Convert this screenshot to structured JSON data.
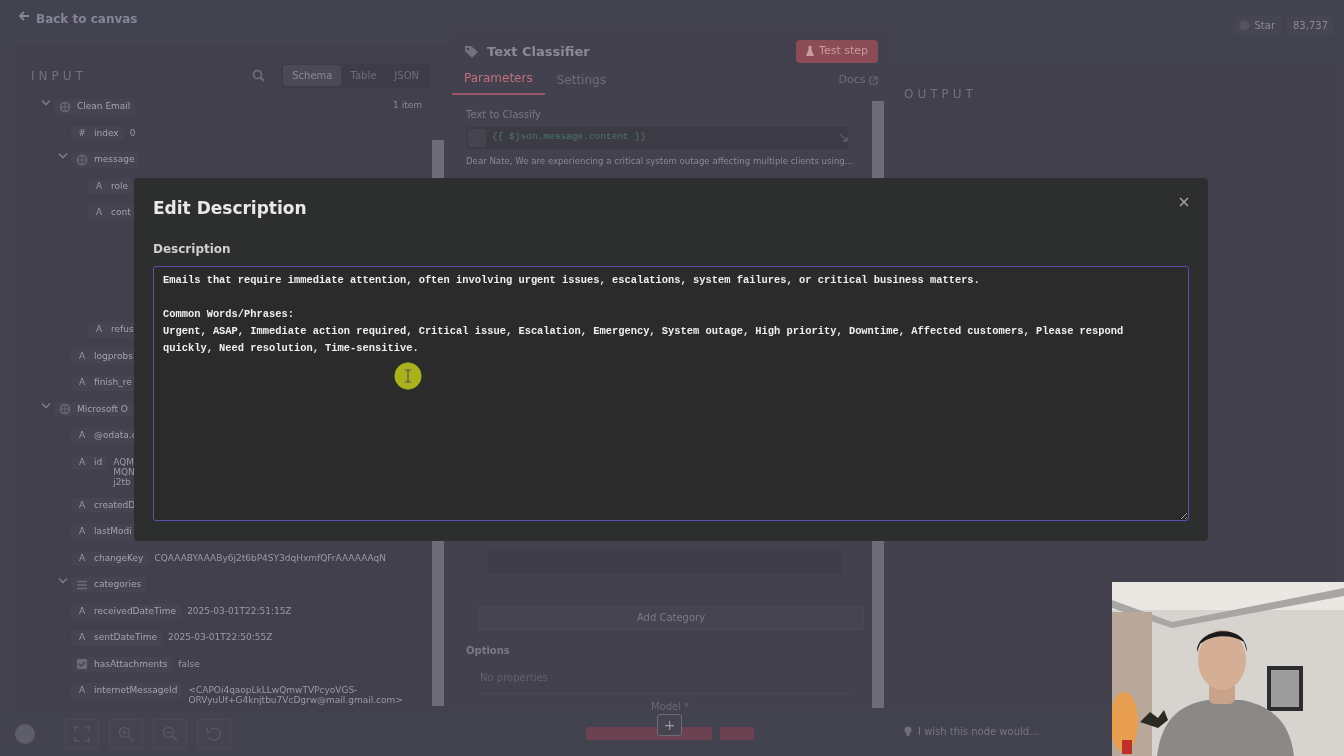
{
  "header": {
    "back_link": "Back to canvas",
    "star_label": "Star",
    "star_count": "83,737"
  },
  "input_panel": {
    "title": "INPUT",
    "view_tabs": [
      {
        "label": "Schema",
        "selected": true
      },
      {
        "label": "Table",
        "selected": false
      },
      {
        "label": "JSON",
        "selected": false
      }
    ],
    "tree": [
      {
        "kind": "object",
        "key": "Clean Email",
        "meta": "1 item",
        "expanded": true,
        "children": [
          {
            "kind": "number",
            "mark": "#",
            "key": "index",
            "value": "0"
          },
          {
            "kind": "object",
            "key": "message",
            "expanded": true,
            "children": [
              {
                "kind": "string",
                "mark": "A",
                "key": "role"
              },
              {
                "kind": "text",
                "mark": "A",
                "key": "cont"
              },
              {
                "kind": "string",
                "mark": "A",
                "key": "refus"
              }
            ]
          },
          {
            "kind": "string",
            "mark": "A",
            "key": "logprobs"
          },
          {
            "kind": "string",
            "mark": "A",
            "key": "finish_re"
          }
        ]
      },
      {
        "kind": "object",
        "key": "Microsoft O",
        "expanded": true,
        "children": [
          {
            "kind": "string",
            "mark": "A",
            "key": "@odata.c"
          },
          {
            "kind": "string",
            "mark": "A",
            "key": "id",
            "value": "AQM\nMQN\nj2tb"
          },
          {
            "kind": "string",
            "mark": "A",
            "key": "createdD"
          },
          {
            "kind": "string",
            "mark": "A",
            "key": "lastModi"
          },
          {
            "kind": "string",
            "mark": "A",
            "key": "changeKey",
            "value": "CQAAABYAAABy6j2t6bP4SY3dqHxmfQFrAAAAAAqN"
          },
          {
            "kind": "list",
            "key": "categories",
            "expanded": true
          },
          {
            "kind": "string",
            "mark": "A",
            "key": "receivedDateTime",
            "value": "2025-03-01T22:51:15Z"
          },
          {
            "kind": "string",
            "mark": "A",
            "key": "sentDateTime",
            "value": "2025-03-01T22:50:55Z"
          },
          {
            "kind": "boolean",
            "key": "hasAttachments",
            "value": "false"
          },
          {
            "kind": "string",
            "mark": "A",
            "key": "internetMessageId",
            "value": "<CAPOi4qaopLkLLwQmwTVPcyoVGS-\nORVyuUf+G4knjtbu7VcDgrw@mail.gmail.com>"
          }
        ]
      }
    ]
  },
  "node_panel": {
    "title": "Text Classifier",
    "test_button": "Test step",
    "tabs": [
      {
        "label": "Parameters",
        "selected": true
      },
      {
        "label": "Settings",
        "selected": false
      }
    ],
    "docs_link": "Docs",
    "text_label": "Text to Classify",
    "expression": "{{ $json.message.content }}",
    "preview": "Dear Nate, We are experiencing a critical system outage affecting multiple clients using...",
    "add_category": "Add Category",
    "options_label": "Options",
    "no_properties": "No properties",
    "model_label": "Model *",
    "add_button": "+"
  },
  "output_panel": {
    "title": "OUTPUT",
    "feedback_placeholder": "I wish this node would..."
  },
  "modal": {
    "title": "Edit Description",
    "field_label": "Description",
    "value": "Emails that require immediate attention, often involving urgent issues, escalations, system failures, or critical business matters.\n\nCommon Words/Phrases:\nUrgent, ASAP, Immediate action required, Critical issue, Escalation, Emergency, System outage, High priority, Downtime, Affected customers, Please respond quickly, Need resolution, Time-sensitive."
  }
}
